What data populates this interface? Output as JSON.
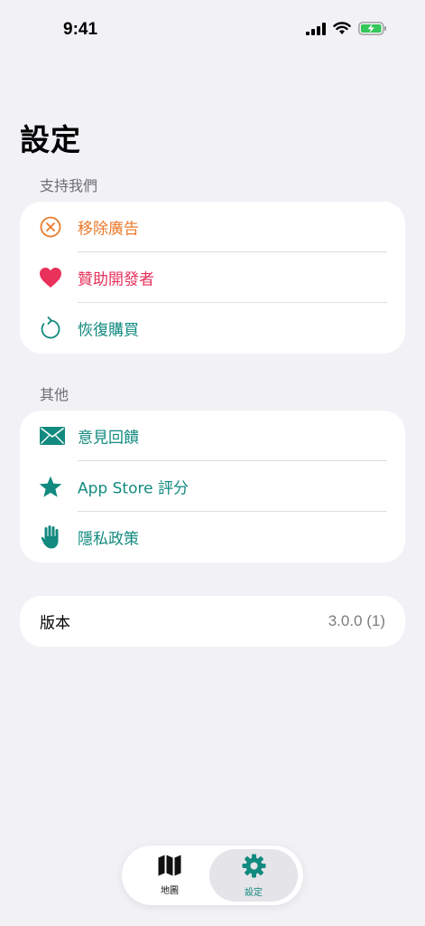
{
  "status_bar": {
    "time": "9:41"
  },
  "page": {
    "title": "設定"
  },
  "sections": {
    "support": {
      "header": "支持我們",
      "items": [
        {
          "label": "移除廣告",
          "icon": "remove-ads-icon",
          "color": "#ea7a2a"
        },
        {
          "label": "贊助開發者",
          "icon": "heart-icon",
          "color": "#e8315b"
        },
        {
          "label": "恢復購買",
          "icon": "restore-icon",
          "color": "#128a7f"
        }
      ]
    },
    "other": {
      "header": "其他",
      "items": [
        {
          "label": "意見回饋",
          "icon": "envelope-icon",
          "color": "#128a7f"
        },
        {
          "label": "App Store 評分",
          "icon": "star-icon",
          "color": "#128a7f"
        },
        {
          "label": "隱私政策",
          "icon": "hand-icon",
          "color": "#128a7f"
        }
      ]
    }
  },
  "version": {
    "label": "版本",
    "value": "3.0.0 (1)"
  },
  "tab_bar": {
    "tabs": [
      {
        "label": "地圖",
        "icon": "map-icon"
      },
      {
        "label": "設定",
        "icon": "gear-icon",
        "selected": true
      }
    ],
    "accent": "#128a7f"
  }
}
